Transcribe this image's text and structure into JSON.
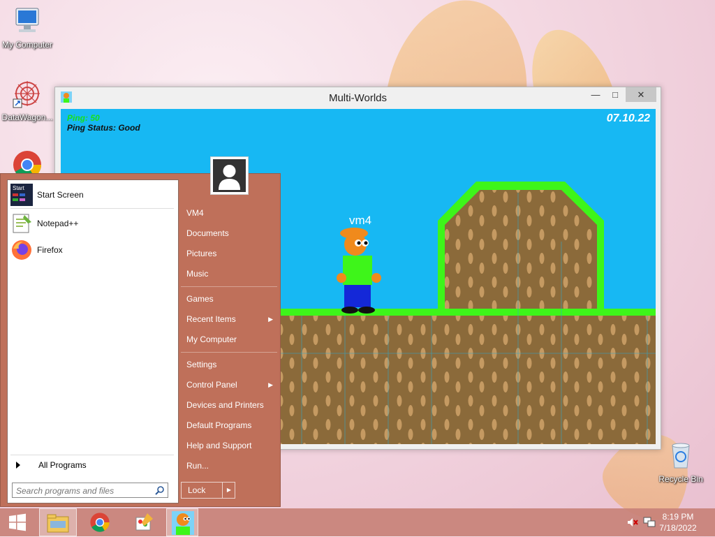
{
  "desktop": {
    "icons": [
      {
        "label": "My Computer"
      },
      {
        "label": "DataWagon..."
      },
      {
        "label": "Google Chrome"
      },
      {
        "label": "Recycle Bin"
      }
    ]
  },
  "game_window": {
    "title": "Multi-Worlds",
    "hud": {
      "ping": "Ping: 50",
      "ping_status": "Ping Status: Good",
      "date": "07.10.22"
    },
    "player_name": "vm4"
  },
  "start_menu": {
    "pinned": [
      {
        "label": "Start Screen"
      },
      {
        "label": "Notepad++"
      },
      {
        "label": "Firefox"
      }
    ],
    "all_programs": "All Programs",
    "search_placeholder": "Search programs and files",
    "right": {
      "user": "VM4",
      "documents": "Documents",
      "pictures": "Pictures",
      "music": "Music",
      "games": "Games",
      "recent_items": "Recent Items",
      "my_computer": "My Computer",
      "settings": "Settings",
      "control_panel": "Control Panel",
      "devices_printers": "Devices and Printers",
      "default_programs": "Default Programs",
      "help_support": "Help and Support",
      "run": "Run..."
    },
    "lock_label": "Lock"
  },
  "taskbar": {
    "time": "8:19 PM",
    "date": "7/18/2022"
  },
  "colors": {
    "accent": "#bf705a",
    "sky": "#17b8f3",
    "grass": "#3ef51a",
    "dirt": "#8b6a3a"
  }
}
